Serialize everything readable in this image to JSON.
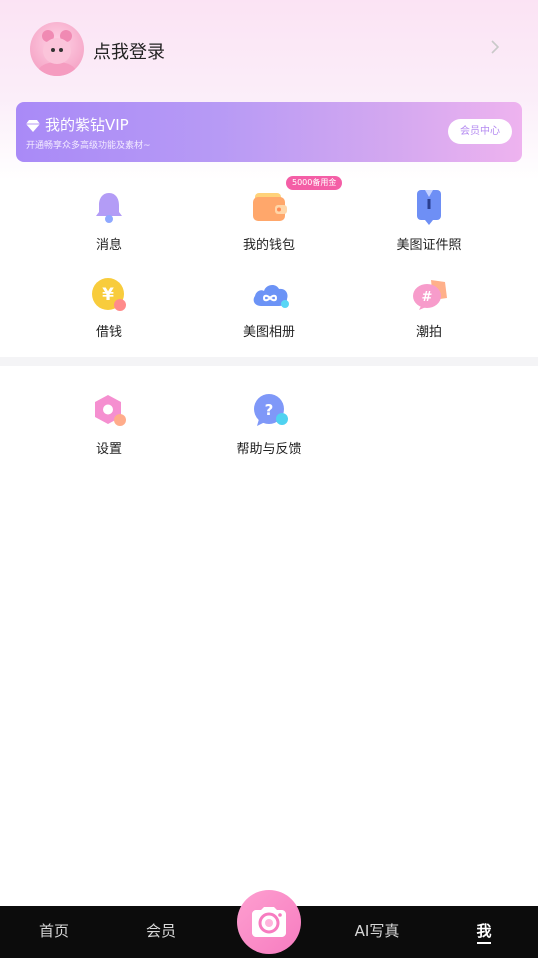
{
  "header": {
    "login_text": "点我登录"
  },
  "vip": {
    "title": "我的紫钻VIP",
    "subtitle": "开通畅享众多高级功能及素材~",
    "button_label": "会员中心"
  },
  "grid": {
    "items": [
      {
        "label": "消息",
        "icon": "bell-icon"
      },
      {
        "label": "我的钱包",
        "icon": "wallet-icon",
        "badge": "5000备用金"
      },
      {
        "label": "美图证件照",
        "icon": "id-photo-icon"
      },
      {
        "label": "借钱",
        "icon": "yen-coin-icon"
      },
      {
        "label": "美图相册",
        "icon": "cloud-album-icon"
      },
      {
        "label": "潮拍",
        "icon": "hashtag-icon"
      }
    ]
  },
  "secondary": {
    "items": [
      {
        "label": "设置",
        "icon": "settings-icon"
      },
      {
        "label": "帮助与反馈",
        "icon": "help-icon"
      }
    ]
  },
  "tabbar": {
    "tabs": [
      {
        "label": "首页"
      },
      {
        "label": "会员"
      },
      {
        "label": "AI写真"
      },
      {
        "label": "我",
        "active": true
      }
    ]
  },
  "colors": {
    "accent_pink": "#f77cc0",
    "vip_purple": "#a98af7",
    "badge_pink": "#f45ea6",
    "tabbar_bg": "#0c0c0c"
  }
}
